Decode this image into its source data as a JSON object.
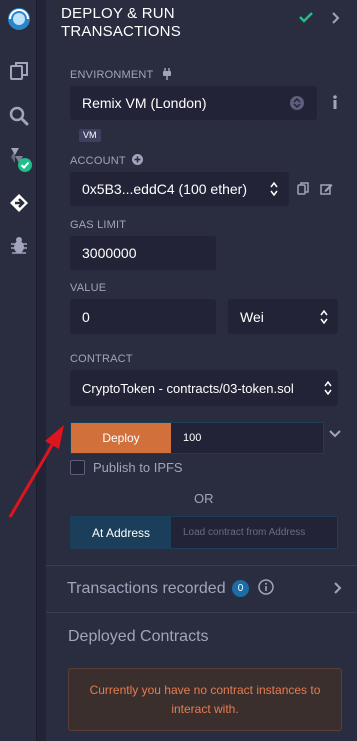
{
  "header": {
    "title_line1": "DEPLOY & RUN",
    "title_line2": "TRANSACTIONS"
  },
  "environment": {
    "label": "ENVIRONMENT",
    "selected": "Remix VM (London)",
    "badge": "VM"
  },
  "account": {
    "label": "ACCOUNT",
    "selected": "0x5B3...eddC4 (100 ether)"
  },
  "gas_limit": {
    "label": "GAS LIMIT",
    "value": "3000000"
  },
  "value": {
    "label": "VALUE",
    "amount": "0",
    "unit": "Wei"
  },
  "contract": {
    "label": "CONTRACT",
    "selected": "CryptoToken - contracts/03-token.sol"
  },
  "deploy": {
    "button_label": "Deploy",
    "args_value": "100",
    "publish_label": "Publish to IPFS",
    "or_label": "OR"
  },
  "at_address": {
    "button_label": "At Address",
    "placeholder": "Load contract from Address"
  },
  "transactions": {
    "title": "Transactions recorded",
    "count": "0"
  },
  "deployed": {
    "title": "Deployed Contracts",
    "empty_message": "Currently you have no contract instances to interact with."
  },
  "colors": {
    "accent_deploy": "#d2703b",
    "accent_address": "#1b3f5a",
    "check": "#1fbe8a",
    "annotation_arrow": "#e0141e"
  }
}
